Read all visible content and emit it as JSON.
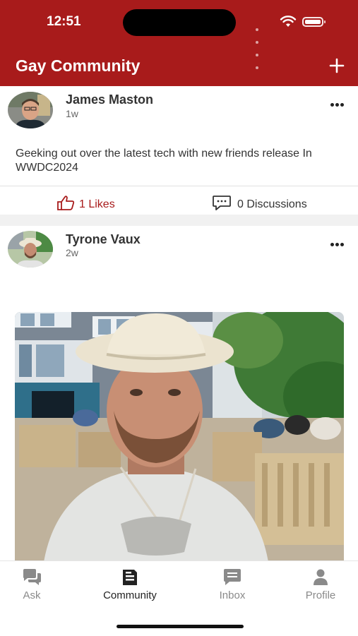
{
  "status_bar": {
    "time": "12:51"
  },
  "header": {
    "title": "Gay Community",
    "add_icon": "plus-icon"
  },
  "posts": [
    {
      "author": "James Maston",
      "age": "1w",
      "text": "Geeking out over the latest tech with new friends release In WWDC2024",
      "likes_label": "1 Likes",
      "discussions_label": "0 Discussions"
    },
    {
      "author": "Tyrone Vaux",
      "age": "2w"
    }
  ],
  "tabs": [
    {
      "label": "Ask",
      "icon": "chat-bubbles-icon"
    },
    {
      "label": "Community",
      "icon": "newspaper-icon",
      "active": true
    },
    {
      "label": "Inbox",
      "icon": "message-icon"
    },
    {
      "label": "Profile",
      "icon": "person-icon"
    }
  ],
  "colors": {
    "brand": "#a81b1b",
    "like": "#a81b1b"
  }
}
